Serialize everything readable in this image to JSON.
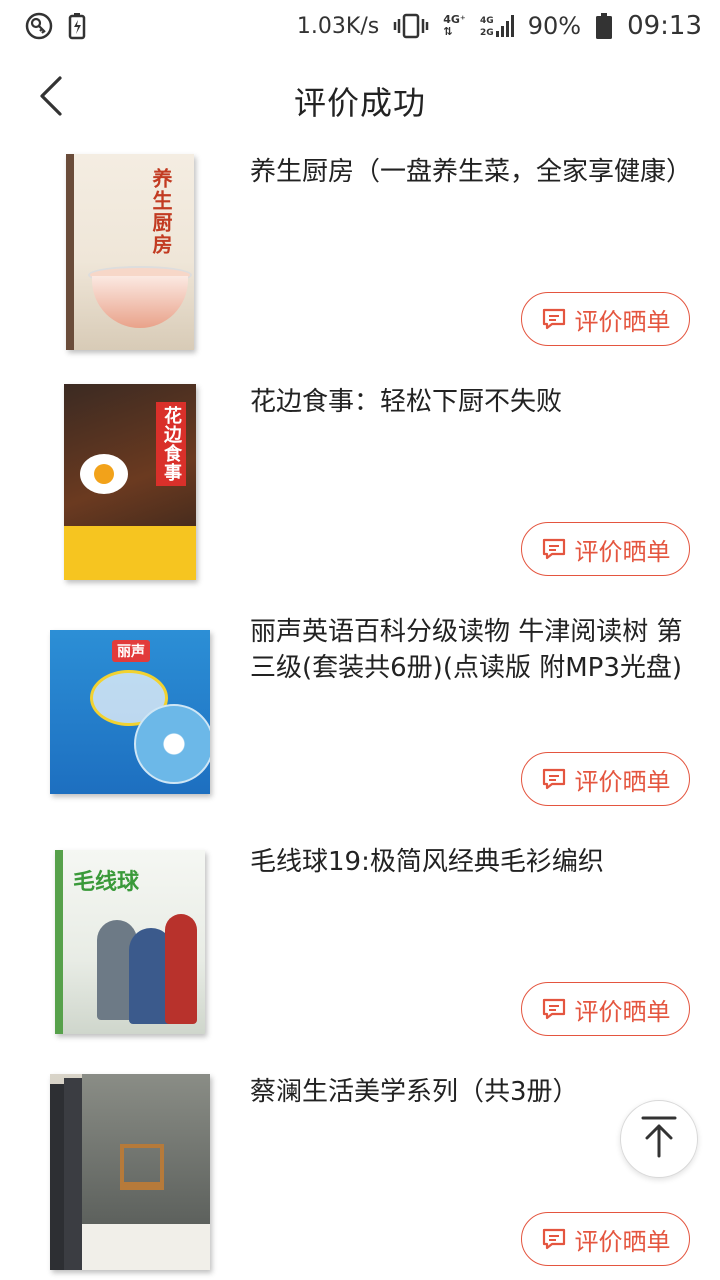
{
  "status_bar": {
    "speed": "1.03K/s",
    "network_top": "4G⁺",
    "network_bottom": "4G 2G",
    "battery": "90%",
    "time": "09:13"
  },
  "header": {
    "title": "评价成功"
  },
  "items": [
    {
      "title": "养生厨房（一盘养生菜，全家享健康）",
      "cover_text": "养生厨房",
      "button_label": "评价晒单"
    },
    {
      "title": "花边食事：轻松下厨不失败",
      "cover_text": "花边食事",
      "button_label": "评价晒单"
    },
    {
      "title": "丽声英语百科分级读物 牛津阅读树 第三级(套装共6册)(点读版 附MP3光盘)",
      "cover_text": "丽声",
      "button_label": "评价晒单"
    },
    {
      "title": "毛线球19:极简风经典毛衫编织",
      "cover_text": "毛线球",
      "button_label": "评价晒单"
    },
    {
      "title": "蔡澜生活美学系列（共3册）",
      "cover_text": "",
      "button_label": "评价晒单"
    }
  ],
  "colors": {
    "accent": "#e4553f"
  }
}
